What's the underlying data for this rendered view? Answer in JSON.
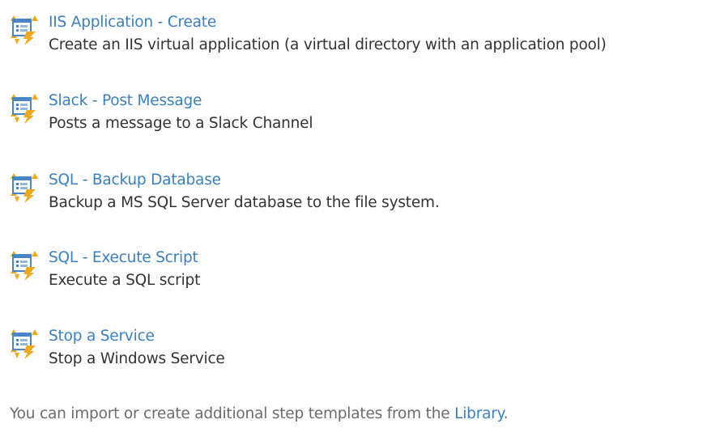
{
  "templates": [
    {
      "title": "IIS Application - Create",
      "description": "Create an IIS virtual application (a virtual directory with an application pool)",
      "icon": "step-template-icon"
    },
    {
      "title": "Slack - Post Message",
      "description": "Posts a message to a Slack Channel",
      "icon": "step-template-icon"
    },
    {
      "title": "SQL - Backup Database",
      "description": "Backup a MS SQL Server database to the file system.",
      "icon": "step-template-icon"
    },
    {
      "title": "SQL - Execute Script",
      "description": "Execute a SQL script",
      "icon": "step-template-icon"
    },
    {
      "title": "Stop a Service",
      "description": "Stop a Windows Service",
      "icon": "step-template-icon"
    }
  ],
  "footer": {
    "text_before": "You can import or create additional step templates from the ",
    "link_label": "Library",
    "text_after": "."
  },
  "colors": {
    "link": "#3a7fc1",
    "text": "#333333",
    "muted": "#6b6b6b",
    "icon_window": "#4a86c5",
    "icon_bolt": "#f0a818"
  }
}
